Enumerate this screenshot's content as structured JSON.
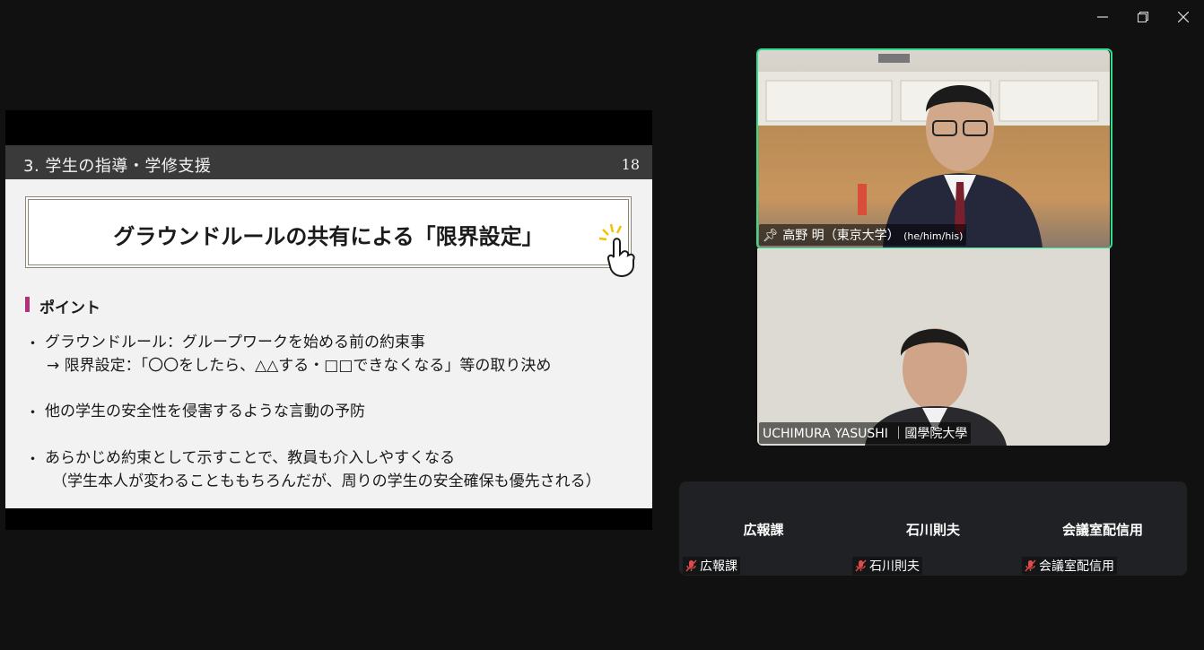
{
  "window": {
    "controls": [
      "minimize",
      "restore",
      "close"
    ]
  },
  "slide": {
    "title": "3.  学生の指導・学修支援",
    "page_number": "18",
    "heading": "グラウンドルールの共有による「限界設定」",
    "section_label": "ポイント",
    "bullet_symbol": "・",
    "bullets": [
      {
        "text": "グラウンドルール：グループワークを始める前の約束事",
        "sub": "→  限界設定：「〇〇をしたら、△△する・□□できなくなる」等の取り決め"
      },
      {
        "text": "他の学生の安全性を侵害するような言動の予防",
        "sub": ""
      },
      {
        "text": "あらかじめ約束として示すことで、教員も介入しやすくなる",
        "sub": "（学生本人が変わることももちろんだが、周りの学生の安全確保も優先される）"
      }
    ],
    "accent_color": "#b3307a"
  },
  "videos": [
    {
      "name": "高野 明（東京大学）",
      "pronouns": "(he/him/his)",
      "pinned": true,
      "active_speaker": true,
      "highlight_color": "#2ee08f"
    },
    {
      "name": "UCHIMURA YASUSHI ｜國學院大學"
    }
  ],
  "participants": [
    {
      "display": "広報課",
      "footer": "広報課",
      "muted": true
    },
    {
      "display": "石川則夫",
      "footer": "石川則夫",
      "muted": true
    },
    {
      "display": "会議室配信用",
      "footer": "会議室配信用",
      "muted": true
    }
  ]
}
